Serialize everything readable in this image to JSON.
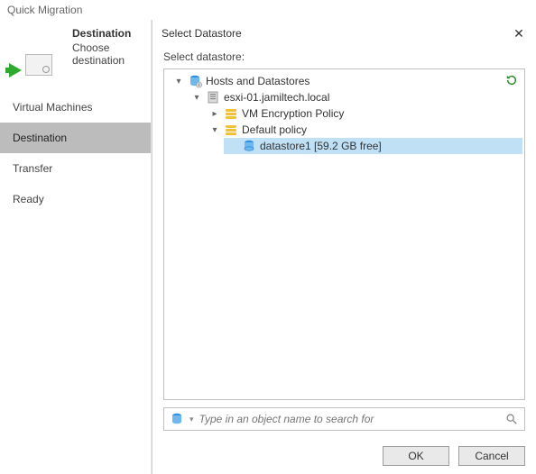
{
  "wizard": {
    "title": "Quick Migration",
    "destination_title": "Destination",
    "destination_desc": "Choose destination",
    "steps": {
      "vm": "Virtual Machines",
      "dest": "Destination",
      "transfer": "Transfer",
      "ready": "Ready"
    }
  },
  "dialog": {
    "title": "Select Datastore",
    "section_label": "Select datastore:",
    "tree": {
      "root": "Hosts and Datastores",
      "host": "esxi-01.jamiltech.local",
      "vm_enc_policy": "VM Encryption Policy",
      "default_policy": "Default policy",
      "datastore": "datastore1 [59.2 GB free]"
    },
    "search_placeholder": "Type in an object name to search for",
    "ok": "OK",
    "cancel": "Cancel"
  }
}
